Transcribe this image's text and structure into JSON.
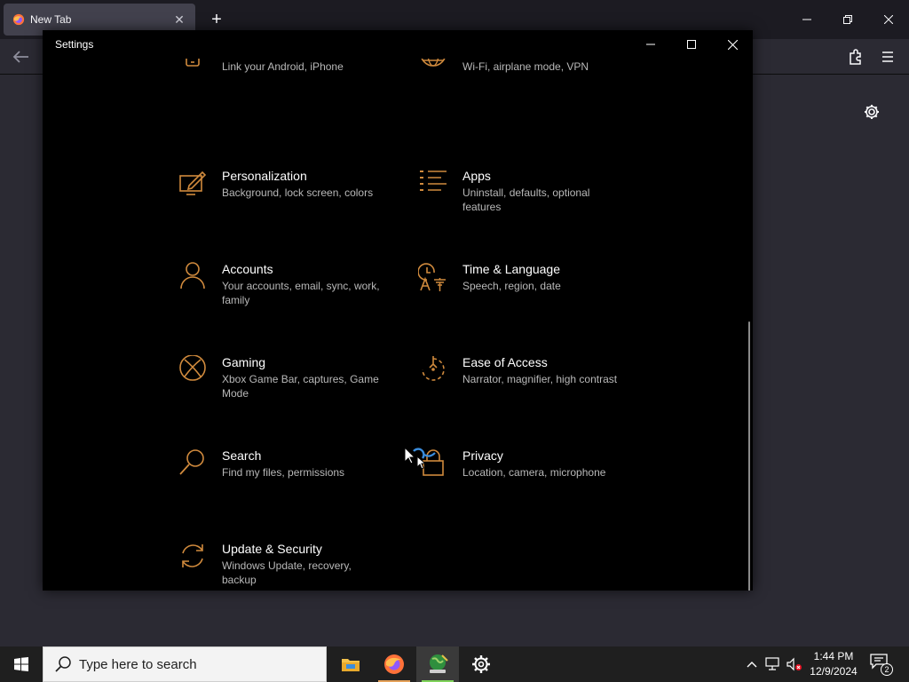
{
  "browser": {
    "tab_title": "New Tab"
  },
  "settings": {
    "window_title": "Settings",
    "accent": "#d08a3d",
    "tiles": [
      {
        "name": "",
        "desc": "Link your Android, iPhone",
        "icon": "phone-icon"
      },
      {
        "name": "",
        "desc": "Wi-Fi, airplane mode, VPN",
        "icon": "globe-icon"
      },
      {
        "name": "Personalization",
        "desc": "Background, lock screen, colors",
        "icon": "personalization-icon"
      },
      {
        "name": "Apps",
        "desc": "Uninstall, defaults, optional features",
        "icon": "apps-icon"
      },
      {
        "name": "Accounts",
        "desc": "Your accounts, email, sync, work, family",
        "icon": "person-icon"
      },
      {
        "name": "Time & Language",
        "desc": "Speech, region, date",
        "icon": "time-language-icon"
      },
      {
        "name": "Gaming",
        "desc": "Xbox Game Bar, captures, Game Mode",
        "icon": "xbox-icon"
      },
      {
        "name": "Ease of Access",
        "desc": "Narrator, magnifier, high contrast",
        "icon": "ease-of-access-icon"
      },
      {
        "name": "Search",
        "desc": "Find my files, permissions",
        "icon": "search-icon"
      },
      {
        "name": "Privacy",
        "desc": "Location, camera, microphone",
        "icon": "lock-icon"
      },
      {
        "name": "Update & Security",
        "desc": "Windows Update, recovery, backup",
        "icon": "sync-icon"
      }
    ]
  },
  "taskbar": {
    "search_placeholder": "Type here to search",
    "time": "1:44 PM",
    "date": "12/9/2024",
    "notification_count": "2"
  }
}
